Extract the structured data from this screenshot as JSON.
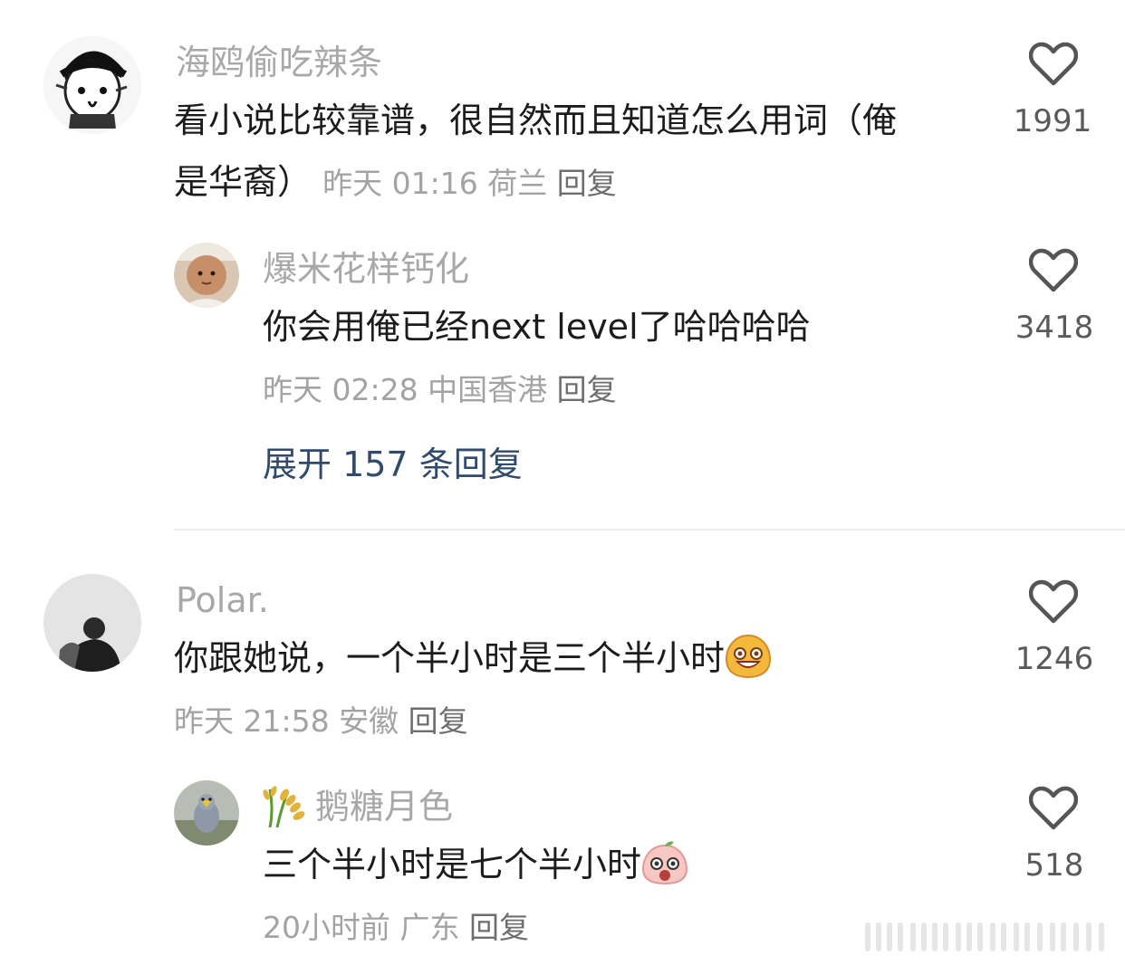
{
  "comments": [
    {
      "username": "海鸥偷吃辣条",
      "text_line1": "看小说比较靠谱，很自然而且知道怎么用词（俺",
      "text_line2": "是华裔）",
      "time": "昨天 01:16",
      "location": "荷兰",
      "reply_label": "回复",
      "likes": "1991",
      "reply": {
        "username": "爆米花样钙化",
        "text": "你会用俺已经next level了哈哈哈哈",
        "time": "昨天 02:28",
        "location": "中国香港",
        "reply_label": "回复",
        "likes": "3418"
      },
      "expand_label": "展开 157 条回复"
    },
    {
      "username": "Polar.",
      "text": "你跟她说，一个半小时是三个半小时",
      "time": "昨天 21:58",
      "location": "安徽",
      "reply_label": "回复",
      "likes": "1246",
      "emoji": "grinning-face-emoji",
      "reply": {
        "username": "鹅糖月色",
        "badge": "rice-ear-icon",
        "text": "三个半小时是七个半小时",
        "time": "20小时前",
        "location": "广东",
        "reply_label": "回复",
        "likes": "518",
        "emoji": "surprised-peach-emoji"
      }
    }
  ],
  "colors": {
    "username": "#a8a8a8",
    "text": "#1c1c1c",
    "meta": "#a3a3a3",
    "expand_link": "#2f4a6e",
    "like_count": "#5a5a5a"
  }
}
